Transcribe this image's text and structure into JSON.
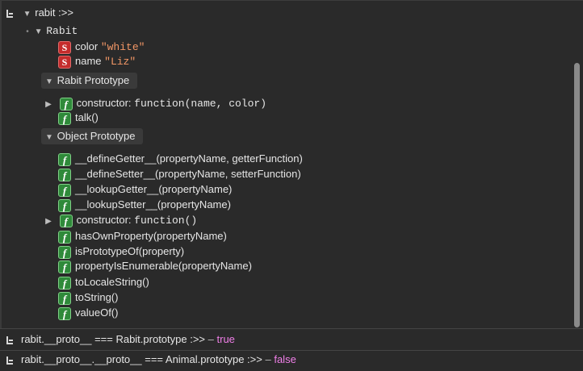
{
  "root": {
    "label": "rabit :>>"
  },
  "object": {
    "class_name": "Rabit",
    "props": [
      {
        "badge": "S",
        "key": "color",
        "value": "\"white\""
      },
      {
        "badge": "S",
        "key": "name",
        "value": "\"Liz\""
      }
    ]
  },
  "rabit_proto": {
    "title": "Rabit Prototype",
    "items": [
      {
        "badge": "f",
        "name": "constructor:",
        "sig": "function(name, color)"
      },
      {
        "badge": "f",
        "name": "talk()"
      }
    ]
  },
  "object_proto": {
    "title": "Object Prototype",
    "items": [
      {
        "badge": "f",
        "name": "__defineGetter__(propertyName, getterFunction)"
      },
      {
        "badge": "f",
        "name": "__defineSetter__(propertyName, setterFunction)"
      },
      {
        "badge": "f",
        "name": "__lookupGetter__(propertyName)"
      },
      {
        "badge": "f",
        "name": "__lookupSetter__(propertyName)"
      },
      {
        "badge": "f",
        "name": "constructor:",
        "sig": "function()"
      },
      {
        "badge": "f",
        "name": "hasOwnProperty(propertyName)"
      },
      {
        "badge": "f",
        "name": "isPrototypeOf(property)"
      },
      {
        "badge": "f",
        "name": "propertyIsEnumerable(propertyName)"
      },
      {
        "badge": "f",
        "name": "toLocaleString()"
      },
      {
        "badge": "f",
        "name": "toString()"
      },
      {
        "badge": "f",
        "name": "valueOf()"
      }
    ]
  },
  "console": [
    {
      "expr": "rabit.__proto__ === Rabit.prototype :>>",
      "dash": "–",
      "result": "true"
    },
    {
      "expr": "rabit.__proto__.__proto__ === Animal.prototype :>>",
      "dash": "–",
      "result": "false"
    }
  ]
}
